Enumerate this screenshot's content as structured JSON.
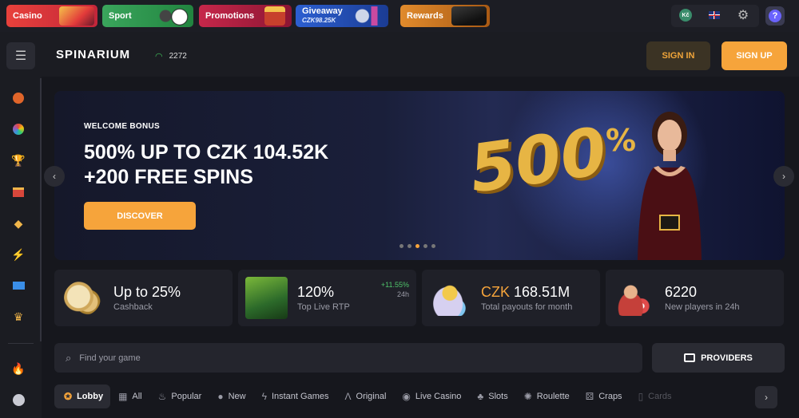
{
  "topbar": {
    "chips": [
      {
        "label": "Casino",
        "icon": "slot-machine-icon"
      },
      {
        "label": "Sport",
        "icon": "soccer-ball-icon"
      },
      {
        "label": "Promotions",
        "icon": "gift-box-icon"
      },
      {
        "label": "Giveaway",
        "sub": "CZK98.25K",
        "icon": "phone-watch-icon"
      },
      {
        "label": "Rewards",
        "icon": "cash-stack-icon"
      }
    ],
    "currency_symbol": "Kč",
    "language_icon": "uk-flag-icon",
    "settings_icon": "gear-icon",
    "help_icon": "question-icon",
    "help_symbol": "?"
  },
  "header": {
    "logo_text": "SPINARIUM",
    "online_count": "2272",
    "sign_in": "SIGN IN",
    "sign_up": "SIGN UP"
  },
  "sidebar": {
    "icons": [
      "basketball-icon",
      "colorful-ball-icon",
      "trophy-icon",
      "gift-icon",
      "diamond-icon",
      "lightning-icon",
      "ticket-icon",
      "crown-icon",
      "fire-icon",
      "new-icon"
    ]
  },
  "hero": {
    "kicker": "WELCOME BONUS",
    "title_line1": "500% UP TO CZK 104.52K",
    "title_line2": "+200 FREE SPINS",
    "cta": "DISCOVER",
    "big_number": "500",
    "big_percent": "%",
    "slides_total": 5,
    "slide_active": 3
  },
  "stats": [
    {
      "value": "Up to 25%",
      "label": "Cashback",
      "icon": "coins-icon"
    },
    {
      "value": "120%",
      "label": "Top Live RTP",
      "change": "+11.55%",
      "period": "24h",
      "icon": "game-thumbnail-icon"
    },
    {
      "value_prefix": "CZK",
      "value": "168.51M",
      "label": "Total payouts for month",
      "icon": "money-bag-icon"
    },
    {
      "value": "6220",
      "label": "New players in 24h",
      "icon": "add-user-icon"
    }
  ],
  "search": {
    "placeholder": "Find your game"
  },
  "providers_label": "PROVIDERS",
  "categories": [
    {
      "label": "Lobby",
      "active": true
    },
    {
      "label": "All"
    },
    {
      "label": "Popular"
    },
    {
      "label": "New"
    },
    {
      "label": "Instant Games"
    },
    {
      "label": "Original"
    },
    {
      "label": "Live Casino"
    },
    {
      "label": "Slots"
    },
    {
      "label": "Roulette"
    },
    {
      "label": "Craps"
    },
    {
      "label": "Cards"
    }
  ],
  "colors": {
    "accent": "#f6a43b",
    "bg": "#16171d",
    "panel": "#1f2028",
    "positive": "#4fc36a"
  }
}
